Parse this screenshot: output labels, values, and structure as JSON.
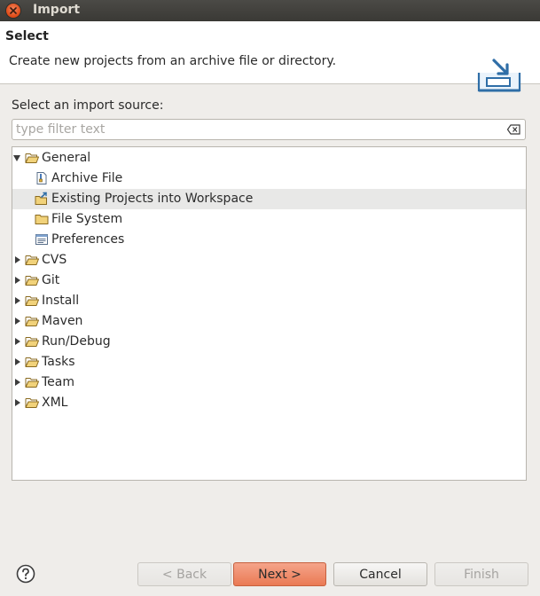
{
  "window": {
    "title": "Import"
  },
  "banner": {
    "title": "Select",
    "description": "Create new projects from an archive file or directory."
  },
  "source": {
    "label": "Select an import source:",
    "filter_placeholder": "type filter text",
    "filter_value": ""
  },
  "tree": {
    "items": [
      {
        "label": "General",
        "level": 0,
        "expander": "open",
        "icon": "folder-open-icon"
      },
      {
        "label": "Archive File",
        "level": 1,
        "expander": "none",
        "icon": "archive-file-icon"
      },
      {
        "label": "Existing Projects into Workspace",
        "level": 1,
        "expander": "none",
        "icon": "existing-projects-icon",
        "selected": true
      },
      {
        "label": "File System",
        "level": 1,
        "expander": "none",
        "icon": "folder-icon"
      },
      {
        "label": "Preferences",
        "level": 1,
        "expander": "none",
        "icon": "preferences-icon"
      },
      {
        "label": "CVS",
        "level": 0,
        "expander": "closed",
        "icon": "folder-open-icon"
      },
      {
        "label": "Git",
        "level": 0,
        "expander": "closed",
        "icon": "folder-open-icon"
      },
      {
        "label": "Install",
        "level": 0,
        "expander": "closed",
        "icon": "folder-open-icon"
      },
      {
        "label": "Maven",
        "level": 0,
        "expander": "closed",
        "icon": "folder-open-icon"
      },
      {
        "label": "Run/Debug",
        "level": 0,
        "expander": "closed",
        "icon": "folder-open-icon"
      },
      {
        "label": "Tasks",
        "level": 0,
        "expander": "closed",
        "icon": "folder-open-icon"
      },
      {
        "label": "Team",
        "level": 0,
        "expander": "closed",
        "icon": "folder-open-icon"
      },
      {
        "label": "XML",
        "level": 0,
        "expander": "closed",
        "icon": "folder-open-icon"
      }
    ]
  },
  "buttons": {
    "back": "< Back",
    "next": "Next >",
    "cancel": "Cancel",
    "finish": "Finish"
  },
  "colors": {
    "accent": "#ea7a54",
    "selection": "#e8e8e7",
    "titlebar": "#3c3b37"
  }
}
